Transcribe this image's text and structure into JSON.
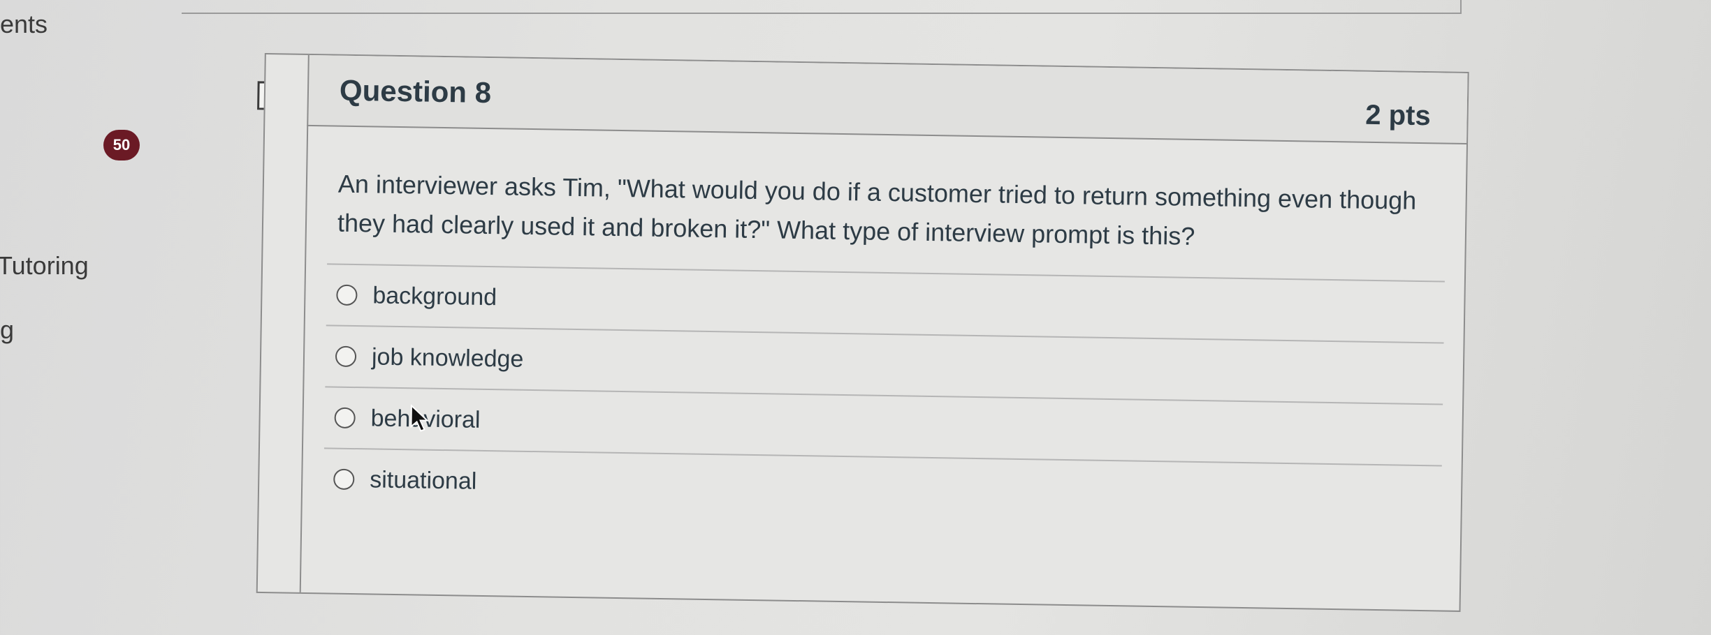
{
  "sidebar": {
    "items": [
      {
        "label": "ents"
      },
      {
        "label": "Tutoring"
      },
      {
        "label": "g"
      }
    ],
    "badge": "50"
  },
  "question": {
    "title": "Question 8",
    "points": "2 pts",
    "text": "An interviewer asks Tim, \"What would you do if a customer tried to return something even though they had clearly used it and broken it?\" What type of interview prompt is this?",
    "answers": [
      {
        "label": "background",
        "selected": false
      },
      {
        "label": "job knowledge",
        "selected": false
      },
      {
        "label": "behavioral",
        "selected": false
      },
      {
        "label": "situational",
        "selected": false
      }
    ]
  },
  "icons": {
    "flag": "flag-bookmark-icon",
    "radio": "radio-button-icon",
    "cursor": "mouse-pointer-icon"
  },
  "colors": {
    "badge": "#6b1a25",
    "text": "#2d3b45",
    "border": "#8c8c8c"
  }
}
